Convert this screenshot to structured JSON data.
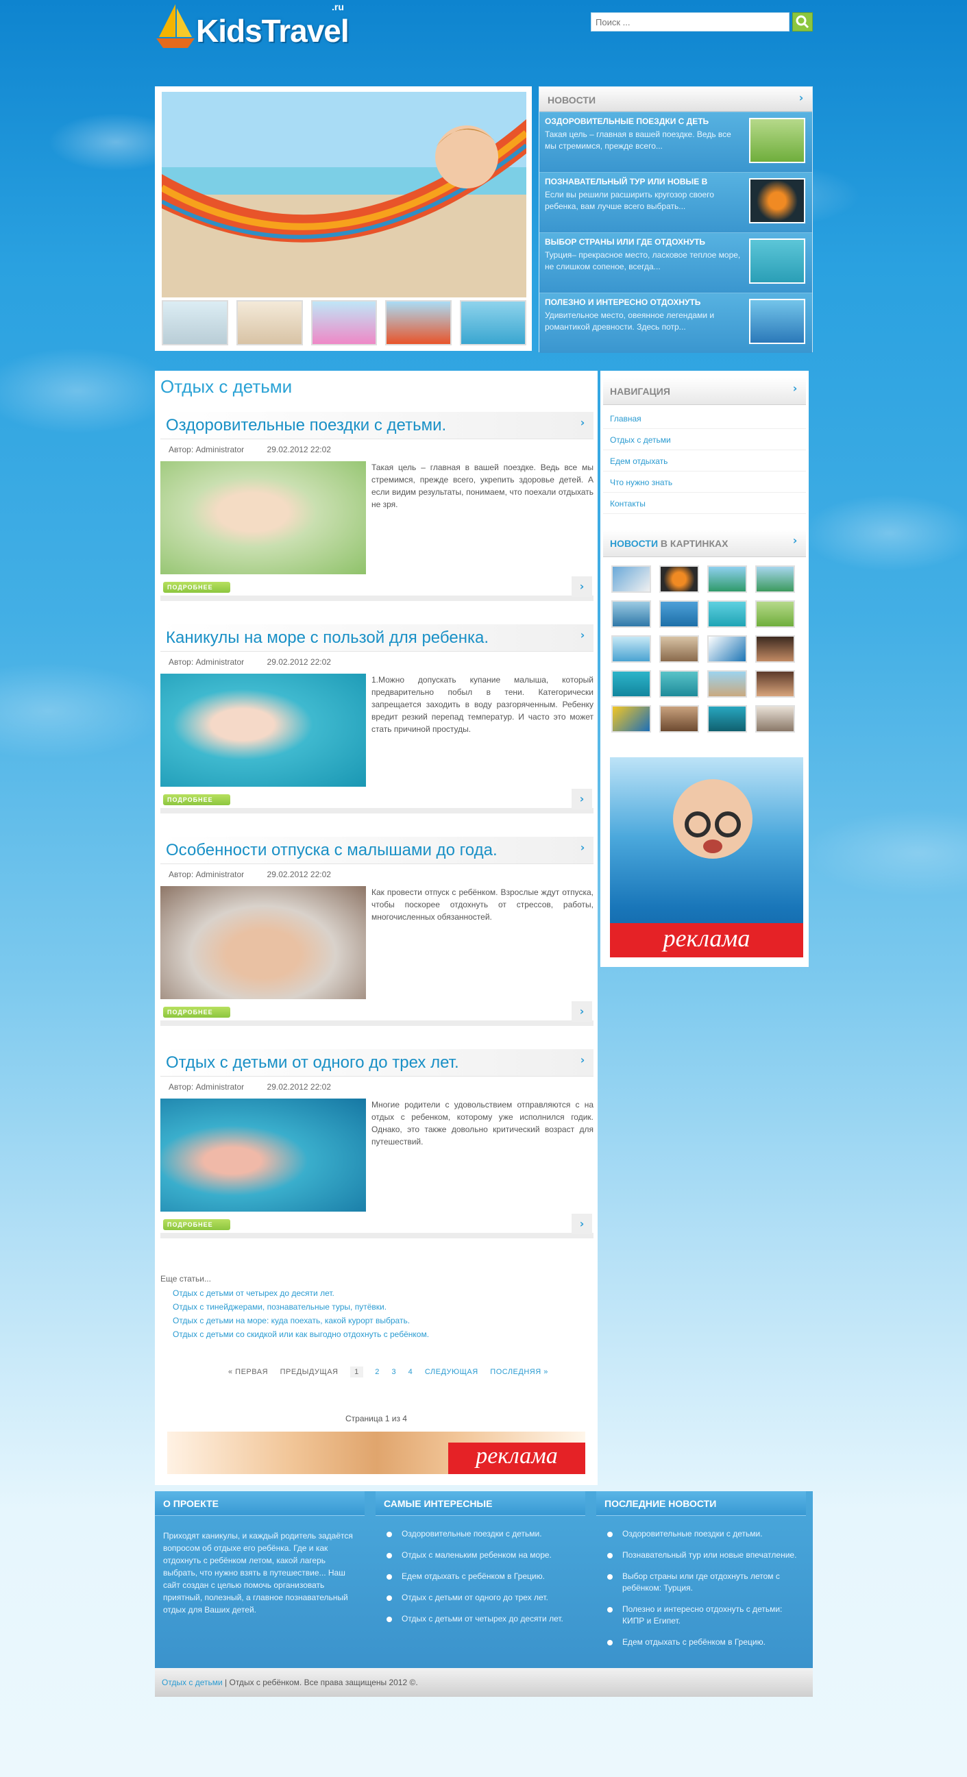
{
  "header": {
    "logo_text": "KidsTravel",
    "logo_suffix": ".ru",
    "search_placeholder": "Поиск ..."
  },
  "newsbox": {
    "title": "НОВОСТИ",
    "items": [
      {
        "title": "ОЗДОРОВИТЕЛЬНЫЕ ПОЕЗДКИ С ДЕТЬ",
        "text": "Такая цель – главная в вашей поездке. Ведь все мы стремимся, прежде всего..."
      },
      {
        "title": "ПОЗНАВАТЕЛЬНЫЙ ТУР ИЛИ НОВЫЕ В",
        "text": "Если вы решили расширить кругозор своего ребенка, вам лучше всего выбрать..."
      },
      {
        "title": "ВЫБОР СТРАНЫ ИЛИ ГДЕ ОТДОХНУТЬ",
        "text": "Турция– прекрасное место, ласковое теплое море, не слишком сопеное, всегда..."
      },
      {
        "title": "ПОЛЕЗНО И ИНТЕРЕСНО ОТДОХНУТЬ",
        "text": "Удивительное место, овеянное легендами и романтикой древности. Здесь потр..."
      }
    ]
  },
  "main": {
    "heading": "Отдых с детьми",
    "posts": [
      {
        "title": "Оздоровительные поездки с детьми.",
        "author": "Автор: Administrator",
        "date": "29.02.2012 22:02",
        "text": "Такая цель – главная в вашей поездке. Ведь все мы стремимся, прежде всего, укрепить здоровье детей. А если видим результаты, понимаем, что поехали отдыхать не зря.",
        "more": "ПОДРОБНЕЕ"
      },
      {
        "title": "Каникулы на море с пользой для ребенка.",
        "author": "Автор: Administrator",
        "date": "29.02.2012 22:02",
        "text": "1.Можно допускать купание малыша, который предварительно побыл в тени. Категорически запрещается заходить в воду разгоряченным. Ребенку вредит резкий перепад температур. И часто это может стать причиной простуды.",
        "more": "ПОДРОБНЕЕ"
      },
      {
        "title": "Особенности отпуска с малышами до года.",
        "author": "Автор: Administrator",
        "date": "29.02.2012 22:02",
        "text": "Как провести отпуск с ребёнком. Взрослые ждут отпуска, чтобы поскорее отдохнуть от стрессов, работы, многочисленных обязанностей.",
        "more": "ПОДРОБНЕЕ"
      },
      {
        "title": "Отдых с детьми от одного до трех лет.",
        "author": "Автор: Administrator",
        "date": "29.02.2012 22:02",
        "text": "Многие родители с удовольствием отправляются с на отдых с ребенком, которому уже исполнился годик. Однако, это также довольно критический возраст для путешествий.",
        "more": "ПОДРОБНЕЕ"
      }
    ],
    "more_articles_label": "Еще статьи...",
    "more_articles": [
      "Отдых с детьми от четырех до десяти лет.",
      "Отдых с тинейджерами, познавательные туры, путёвки.",
      "Отдых с детьми на море: куда поехать, какой курорт выбрать.",
      "Отдых с детьми со скидкой или как выгодно отдохнуть с ребёнком."
    ],
    "pager": {
      "first": "« ПЕРВАЯ",
      "prev": "ПРЕДЫДУЩАЯ",
      "pages": [
        "1",
        "2",
        "3",
        "4"
      ],
      "next": "СЛЕДУЮЩАЯ",
      "last": "ПОСЛЕДНЯЯ »"
    },
    "page_info": "Страница 1 из 4",
    "banner_text": "реклама"
  },
  "sidebar": {
    "nav_title": "НАВИГАЦИЯ",
    "nav_items": [
      "Главная",
      "Отдых с детьми",
      "Едем отдыхать",
      "Что нужно знать",
      "Контакты"
    ],
    "gallery_title_a": "НОВОСТИ",
    "gallery_title_b": "В КАРТИНКАХ",
    "ad_text": "реклама"
  },
  "footer": {
    "about_title": "О ПРОЕКТЕ",
    "about_text": "Приходят каникулы, и каждый родитель задаётся вопросом об отдыхе его ребёнка. Где и как отдохнуть с ребёнком летом, какой лагерь выбрать, что нужно взять в путешествие... Наш сайт создан с целью помочь организовать приятный, полезный, а главное познавательный отдых для Ваших детей.",
    "popular_title": "САМЫЕ ИНТЕРЕСНЫЕ",
    "popular": [
      "Оздоровительные поездки с детьми.",
      "Отдых с маленьким ребенком на море.",
      "Едем отдыхать с ребёнком в Грецию.",
      "Отдых с детьми от одного до трех лет.",
      "Отдых с детьми от четырех до десяти лет."
    ],
    "latest_title": "ПОСЛЕДНИЕ НОВОСТИ",
    "latest": [
      "Оздоровительные поездки с детьми.",
      "Познавательный тур или новые впечатление.",
      "Выбор страны или где отдохнуть летом с ребёнком: Турция.",
      "Полезно и интересно отдохнуть с детьми: КИПР и Египет.",
      "Едем отдыхать с ребёнком в Грецию."
    ],
    "copyright_link": "Отдых с детьми",
    "copyright_text": " | Отдых с ребёнком. Все права защищены 2012 ©."
  },
  "colors": {
    "accent": "#2a9bd1",
    "green": "#8cc63f",
    "ad_red": "#e52226"
  }
}
